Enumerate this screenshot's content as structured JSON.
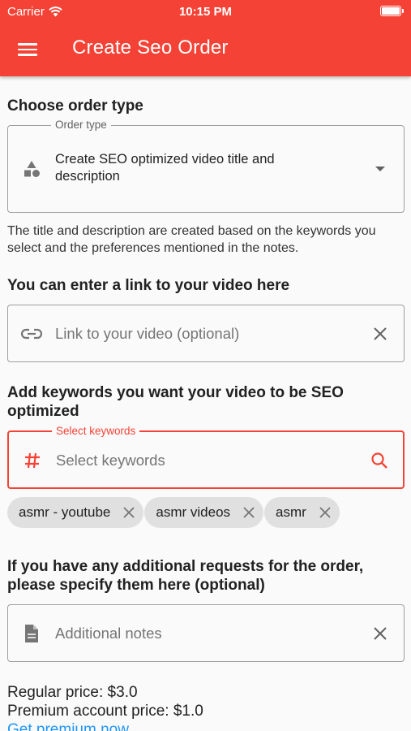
{
  "status_bar": {
    "carrier": "Carrier",
    "time": "10:15 PM"
  },
  "appbar": {
    "title": "Create Seo Order",
    "menu_icon": "menu-icon"
  },
  "order_type": {
    "heading": "Choose order type",
    "legend": "Order type",
    "value_line1": "Create SEO optimized video title and",
    "value_line2": "description",
    "icon": "category-shapes-icon",
    "description": "The title and description are created based on the keywords you select and the preferences mentioned in the notes."
  },
  "link": {
    "heading": "You can enter a link to your video here",
    "placeholder": "Link to your video (optional)",
    "icon": "link-icon"
  },
  "keywords": {
    "heading_line1": "Add keywords you want your video to be SEO",
    "heading_line2": "optimized",
    "legend": "Select keywords",
    "placeholder": "Select keywords",
    "icon": "hashtag-icon",
    "chips": [
      {
        "label": "asmr - youtube"
      },
      {
        "label": "asmr videos"
      },
      {
        "label": "asmr"
      }
    ],
    "accent_color": "#f44336"
  },
  "notes": {
    "heading_line1": "If you have any additional requests for the order,",
    "heading_line2": "please specify them here (optional)",
    "placeholder": "Additional notes",
    "icon": "document-icon"
  },
  "pricing": {
    "regular": "Regular price: $3.0",
    "premium": "Premium account price: $1.0",
    "premium_link": "Get premium now"
  },
  "colors": {
    "primary": "#f44336",
    "link": "#2196f3"
  }
}
